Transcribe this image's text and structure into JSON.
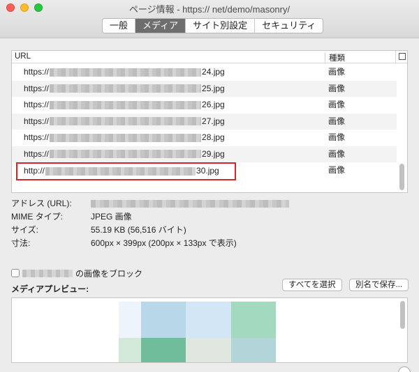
{
  "window": {
    "title": "ページ情報 - https://            net/demo/masonry/"
  },
  "tabs": [
    {
      "label": "一般"
    },
    {
      "label": "メディア"
    },
    {
      "label": "サイト別設定"
    },
    {
      "label": "セキュリティ"
    }
  ],
  "table": {
    "col_url": "URL",
    "col_type": "種類",
    "rows": [
      {
        "prefix": "https://",
        "suffix": "24.jpg",
        "type": "画像"
      },
      {
        "prefix": "https://",
        "suffix": "25.jpg",
        "type": "画像"
      },
      {
        "prefix": "https://",
        "suffix": "26.jpg",
        "type": "画像"
      },
      {
        "prefix": "https://",
        "suffix": "27.jpg",
        "type": "画像"
      },
      {
        "prefix": "https://",
        "suffix": "28.jpg",
        "type": "画像"
      },
      {
        "prefix": "https://",
        "suffix": "29.jpg",
        "type": "画像"
      },
      {
        "prefix": "http://",
        "suffix": "30.jpg",
        "type": "画像"
      }
    ]
  },
  "props": {
    "address_label": "アドレス (URL):",
    "mime_label": "MIME タイプ:",
    "mime_value": "JPEG 画像",
    "size_label": "サイズ:",
    "size_value": "55.19 KB (56,516 バイト)",
    "dims_label": "寸法:",
    "dims_value": "600px × 399px (200px × 133px で表示)"
  },
  "block": {
    "label": "の画像をブロック"
  },
  "preview": {
    "label": "メディアプレビュー:"
  },
  "buttons": {
    "select_all": "すべてを選択",
    "save_as": "別名で保存..."
  },
  "colors": {
    "selection_outline": "#d9252a",
    "active_tab": "#6e6e6e",
    "preview_tiles": [
      "#eef4fb",
      "#b8d8ea",
      "#d3e6f6",
      "#a3d9bf",
      "#d3eadb",
      "#6fbd9b",
      "#dfe7de",
      "#b2d6d8"
    ]
  }
}
